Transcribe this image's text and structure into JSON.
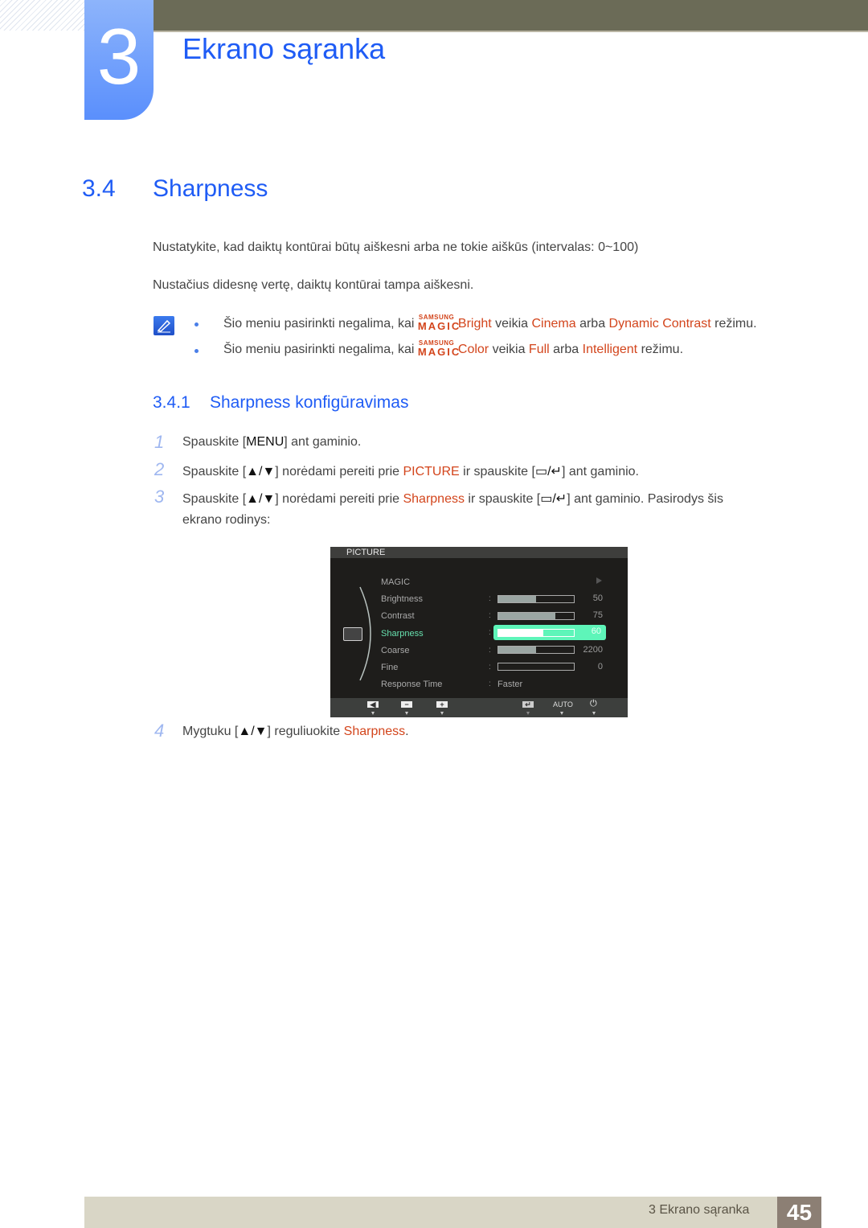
{
  "header": {
    "chapter_number": "3",
    "chapter_title": "Ekrano sąranka"
  },
  "section": {
    "number": "3.4",
    "title": "Sharpness",
    "description_1": "Nustatykite, kad daiktų kontūrai būtų aiškesni arba ne tokie aiškūs (intervalas: 0~100)",
    "description_2": "Nustačius didesnę vertę, daiktų kontūrai tampa aiškesni."
  },
  "notes": [
    {
      "prefix": "Šio meniu pasirinkti negalima, kai ",
      "brand_top": "SAMSUNG",
      "brand_bottom": "MAGIC",
      "feature": "Bright",
      "mid1": " veikia ",
      "mode1": "Cinema",
      "mid2": " arba ",
      "mode2": "Dynamic Contrast",
      "suffix": " režimu."
    },
    {
      "prefix": "Šio meniu pasirinkti negalima, kai ",
      "brand_top": "SAMSUNG",
      "brand_bottom": "MAGIC",
      "feature": "Color",
      "mid1": " veikia ",
      "mode1": "Full",
      "mid2": " arba ",
      "mode2": "Intelligent",
      "suffix": " režimu."
    }
  ],
  "subsection": {
    "number": "3.4.1",
    "title": "Sharpness konfigūravimas"
  },
  "steps": [
    {
      "num": "1",
      "a": "Spauskite [",
      "key": "MENU",
      "b": "] ant gaminio."
    },
    {
      "num": "2",
      "a": "Spauskite [",
      "key": "▲/▼",
      "b": "] norėdami pereiti prie ",
      "target": "PICTURE",
      "c": " ir spauskite [",
      "key2": "▭/↵",
      "d": "] ant gaminio."
    },
    {
      "num": "3",
      "a": "Spauskite [",
      "key": "▲/▼",
      "b": "] norėdami pereiti prie ",
      "target": "Sharpness",
      "c": " ir spauskite [",
      "key2": "▭/↵",
      "d": "] ant gaminio. Pasirodys šis",
      "e": "ekrano rodinys:"
    },
    {
      "num": "4",
      "a": "Mygtuku [",
      "key": "▲/▼",
      "b": "] reguliuokite ",
      "target": "Sharpness",
      "c": "."
    }
  ],
  "osd": {
    "title": "PICTURE",
    "items": [
      {
        "label": "MAGIC",
        "value": null
      },
      {
        "label": "Brightness",
        "value": "50",
        "level": 50
      },
      {
        "label": "Contrast",
        "value": "75",
        "level": 75
      },
      {
        "label": "Sharpness",
        "value": "60",
        "level": 60,
        "selected": true
      },
      {
        "label": "Coarse",
        "value": "2200",
        "level": 50
      },
      {
        "label": "Fine",
        "value": "0",
        "level": 0
      },
      {
        "label": "Response Time",
        "value": "Faster"
      }
    ],
    "footer_auto": "AUTO"
  },
  "footer": {
    "chapter": "3 Ekrano sąranka",
    "page": "45"
  }
}
